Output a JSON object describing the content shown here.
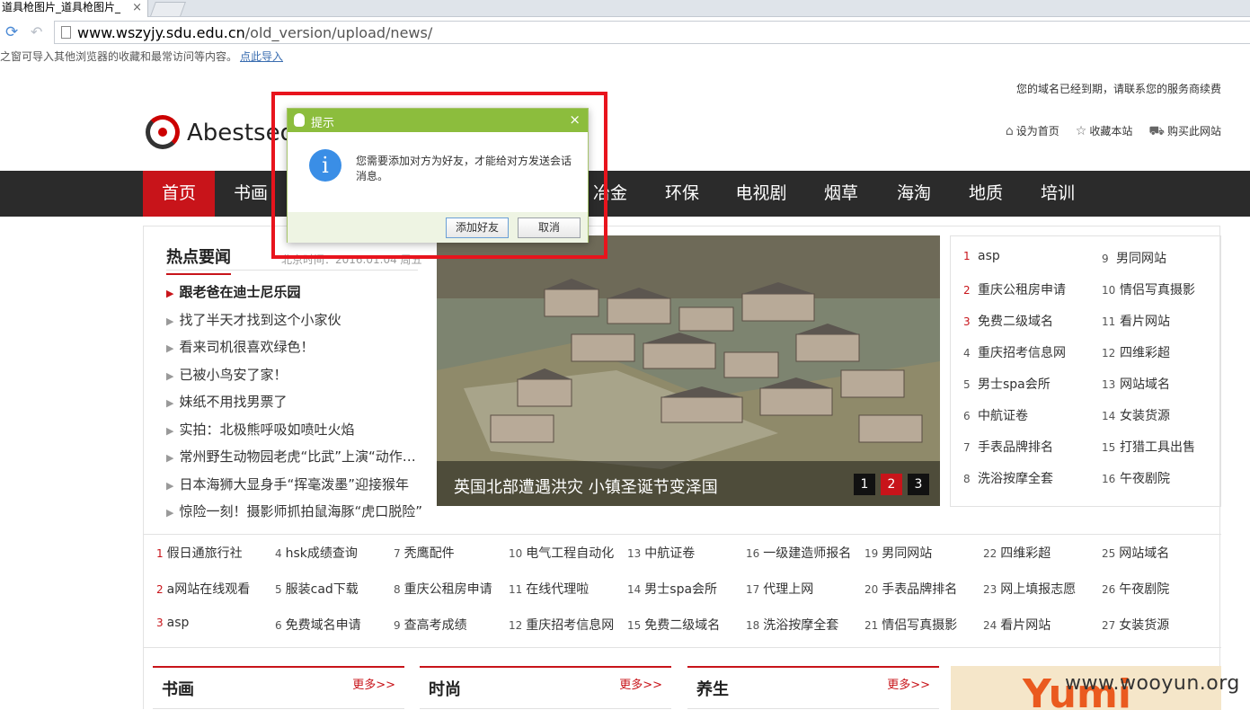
{
  "browser": {
    "tab_title": "道具枪图片_道具枪图片_",
    "tab_close": "×",
    "url_host": "www.wszyjy.sdu.edu.cn",
    "url_path": "/old_version/upload/news/",
    "bookmark_text": "之窗可导入其他浏览器的收藏和最常访问等内容。",
    "bookmark_link": "点此导入"
  },
  "site": {
    "domain_notice": "您的域名已经到期，请联系您的服务商续费",
    "logo_text": "Abestseo.",
    "top_links": [
      "设为首页",
      "收藏本站",
      "购买此网站"
    ],
    "nav": [
      {
        "label": "首页",
        "active": true
      },
      {
        "label": "书画"
      },
      {
        "label": "冶金"
      },
      {
        "label": "环保"
      },
      {
        "label": "电视剧"
      },
      {
        "label": "烟草"
      },
      {
        "label": "海淘"
      },
      {
        "label": "地质"
      },
      {
        "label": "培训"
      }
    ]
  },
  "hot": {
    "title": "热点要闻",
    "time": "北京时间：2016.01.04 周五",
    "items": [
      "跟老爸在迪士尼乐园",
      "找了半天才找到这个小家伙",
      "看来司机很喜欢绿色！",
      "已被小鸟安了家！",
      "妹纸不用找男票了",
      "实拍：北极熊呼吸如喷吐火焰",
      "常州野生动物园老虎“比武”上演“动作大片”",
      "日本海狮大显身手“挥毫泼墨”迎接猴年",
      "惊险一刻！摄影师抓拍鼠海豚“虎口脱险”"
    ]
  },
  "slider": {
    "caption": "英国北部遭遇洪灾 小镇圣诞节变泽国",
    "dots": [
      "1",
      "2",
      "3"
    ],
    "active_dot": "2"
  },
  "rank": [
    {
      "n": "1",
      "t": "asp"
    },
    {
      "n": "2",
      "t": "重庆公租房申请"
    },
    {
      "n": "3",
      "t": "免费二级域名"
    },
    {
      "n": "4",
      "t": "重庆招考信息网"
    },
    {
      "n": "5",
      "t": "男士spa会所"
    },
    {
      "n": "6",
      "t": "中航证卷"
    },
    {
      "n": "7",
      "t": "手表品牌排名"
    },
    {
      "n": "8",
      "t": "洗浴按摩全套"
    },
    {
      "n": "9",
      "t": "男同网站"
    },
    {
      "n": "10",
      "t": "情侣写真摄影"
    },
    {
      "n": "11",
      "t": "看片网站"
    },
    {
      "n": "12",
      "t": "四维彩超"
    },
    {
      "n": "13",
      "t": "网站域名"
    },
    {
      "n": "14",
      "t": "女装货源"
    },
    {
      "n": "15",
      "t": "打猎工具出售"
    },
    {
      "n": "16",
      "t": "午夜剧院"
    }
  ],
  "links": [
    {
      "n": "1",
      "t": "假日通旅行社"
    },
    {
      "n": "2",
      "t": "a网站在线观看"
    },
    {
      "n": "3",
      "t": "asp"
    },
    {
      "n": "4",
      "t": "hsk成绩查询"
    },
    {
      "n": "5",
      "t": "服装cad下载"
    },
    {
      "n": "6",
      "t": "免费域名申请"
    },
    {
      "n": "7",
      "t": "秃鹰配件"
    },
    {
      "n": "8",
      "t": "重庆公租房申请"
    },
    {
      "n": "9",
      "t": "查高考成绩"
    },
    {
      "n": "10",
      "t": "电气工程自动化"
    },
    {
      "n": "11",
      "t": "在线代理啦"
    },
    {
      "n": "12",
      "t": "重庆招考信息网"
    },
    {
      "n": "13",
      "t": "中航证卷"
    },
    {
      "n": "14",
      "t": "男士spa会所"
    },
    {
      "n": "15",
      "t": "免费二级域名"
    },
    {
      "n": "16",
      "t": "一级建造师报名"
    },
    {
      "n": "17",
      "t": "代理上网"
    },
    {
      "n": "18",
      "t": "洗浴按摩全套"
    },
    {
      "n": "19",
      "t": "男同网站"
    },
    {
      "n": "20",
      "t": "手表品牌排名"
    },
    {
      "n": "21",
      "t": "情侣写真摄影"
    },
    {
      "n": "22",
      "t": "四维彩超"
    },
    {
      "n": "23",
      "t": "网上填报志愿"
    },
    {
      "n": "24",
      "t": "看片网站"
    },
    {
      "n": "25",
      "t": "网站域名"
    },
    {
      "n": "26",
      "t": "午夜剧院"
    },
    {
      "n": "27",
      "t": "女装货源"
    }
  ],
  "sections": [
    {
      "title": "书画",
      "more": "更多>>"
    },
    {
      "title": "时尚",
      "more": "更多>>"
    },
    {
      "title": "养生",
      "more": "更多>>"
    }
  ],
  "ad": {
    "text": "Yumi"
  },
  "watermark": "www.wooyun.org",
  "dialog": {
    "title": "提示",
    "close": "×",
    "info_glyph": "i",
    "message": "您需要添加对方为好友，才能给对方发送会话消息。",
    "add_button": "添加好友",
    "cancel_button": "取消"
  },
  "colors": {
    "accent": "#c8141a",
    "nav_bg": "#2b2b2b",
    "dialog_header": "#8cbd3d",
    "highlight": "#e8141d"
  }
}
